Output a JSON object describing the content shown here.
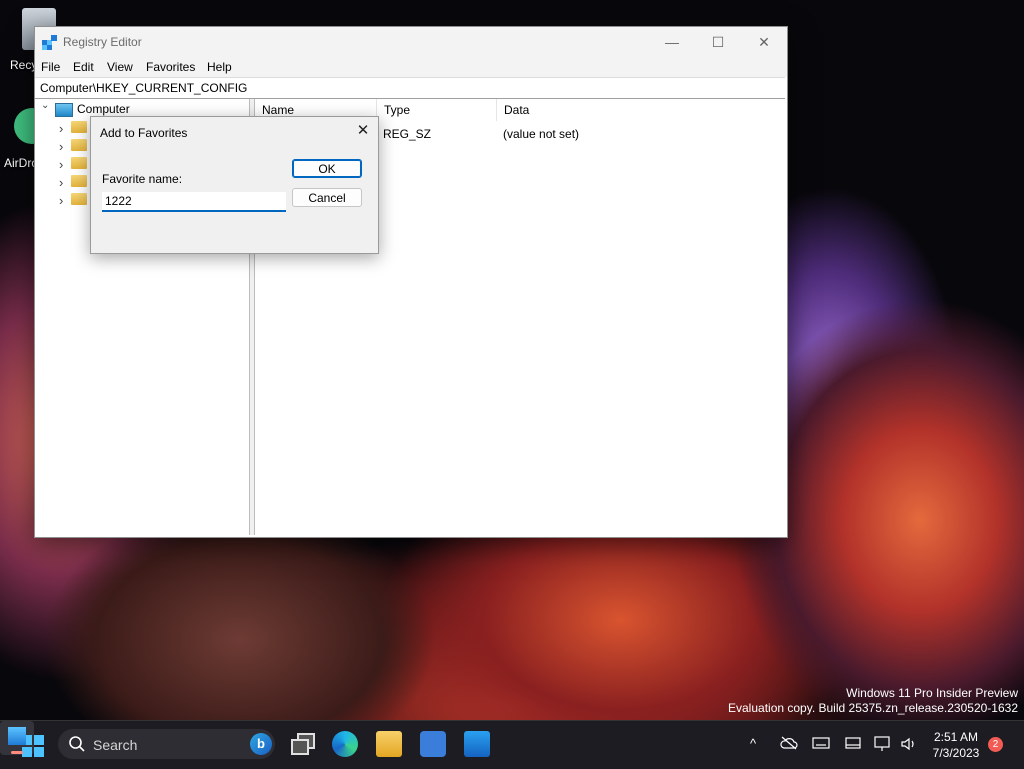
{
  "desktop": {
    "icons": [
      {
        "label": "Recy"
      },
      {
        "label": "AirDro"
      }
    ],
    "watermark": {
      "line1": "Windows 11 Pro Insider Preview",
      "line2": "Evaluation copy. Build 25375.zn_release.230520-1632"
    }
  },
  "window": {
    "title": "Registry Editor",
    "controls": {
      "minimize": "—",
      "maximize": "☐",
      "close": "✕"
    },
    "menu": [
      "File",
      "Edit",
      "View",
      "Favorites",
      "Help"
    ],
    "address": "Computer\\HKEY_CURRENT_CONFIG",
    "tree": {
      "root_label": "Computer",
      "expanded_glyph": "⌄",
      "collapsed_glyph": "›",
      "child_count": 5
    },
    "list": {
      "columns": [
        "Name",
        "Type",
        "Data"
      ],
      "rows": [
        {
          "name": "",
          "type": "REG_SZ",
          "data": "(value not set)"
        }
      ]
    }
  },
  "dialog": {
    "title": "Add to Favorites",
    "close_glyph": "✕",
    "label": "Favorite name:",
    "value": "1222",
    "ok_label": "OK",
    "cancel_label": "Cancel"
  },
  "taskbar": {
    "search_placeholder": "Search",
    "search_icon": "magnifier-icon",
    "bing_glyph": "b",
    "tray": {
      "chevron": "^",
      "clock_time": "2:51 AM",
      "clock_date": "7/3/2023",
      "notification_count": "2"
    }
  },
  "colors": {
    "accent": "#0067c0",
    "taskbar_bg": "#1c1c22",
    "start_blue": "#4cc2ff",
    "notification": "#f25c54"
  }
}
